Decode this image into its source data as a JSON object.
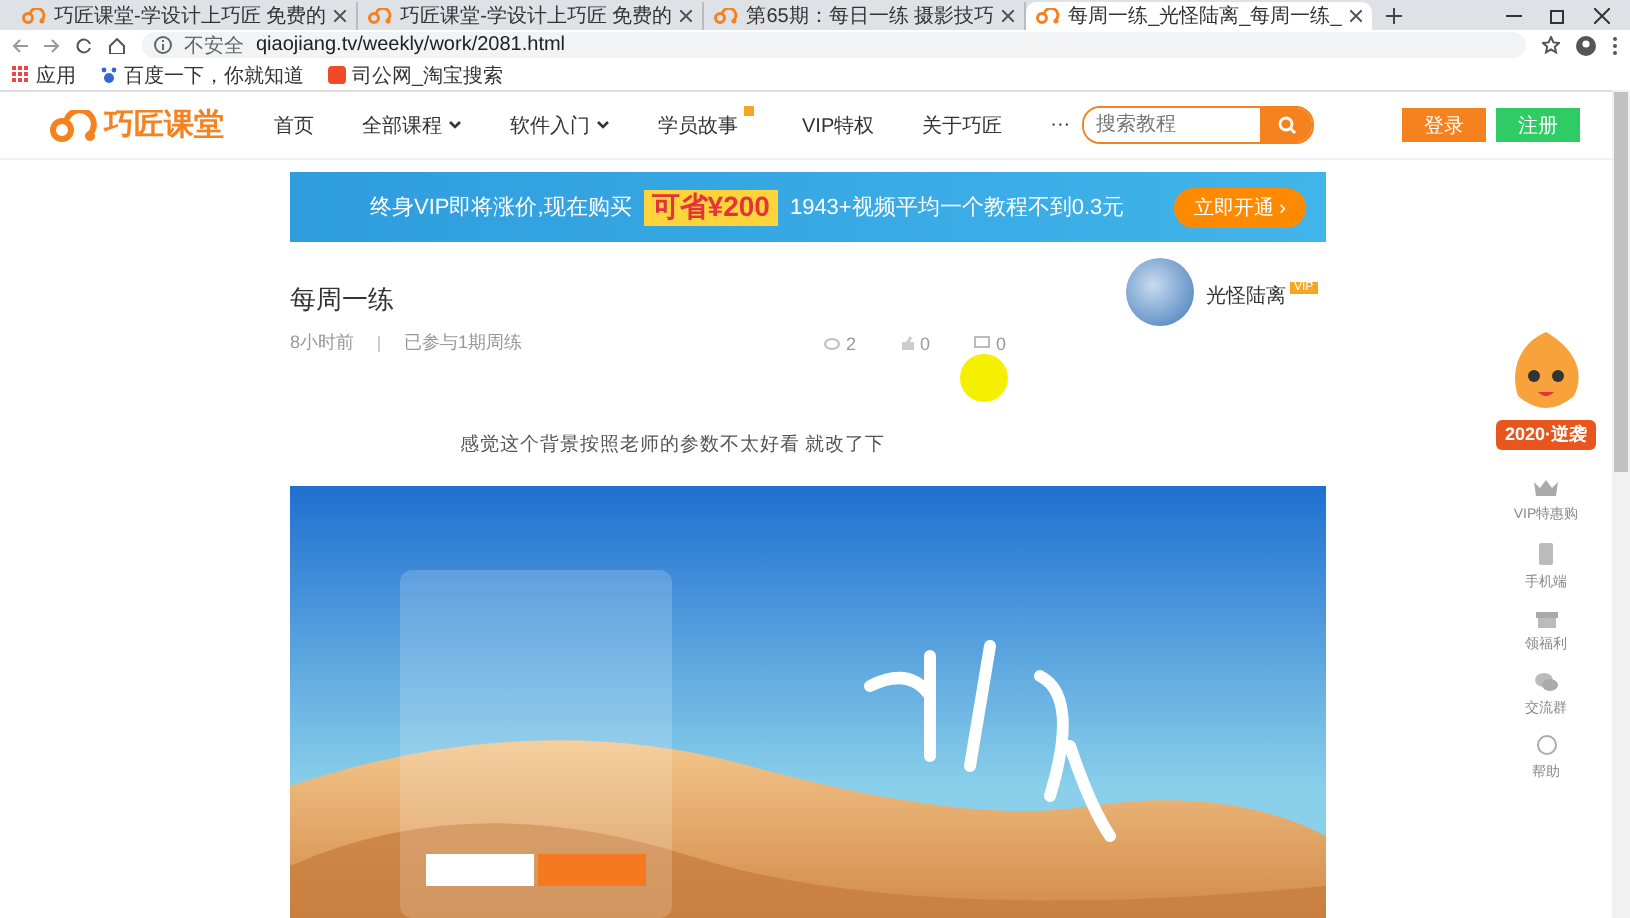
{
  "browser": {
    "tabs": [
      {
        "title": "巧匠课堂-学设计上巧匠 免费的",
        "selected": false
      },
      {
        "title": "巧匠课堂-学设计上巧匠 免费的",
        "selected": false
      },
      {
        "title": "第65期：每日一练 摄影技巧",
        "selected": false
      },
      {
        "title": "每周一练_光怪陆离_每周一练_",
        "selected": true
      }
    ],
    "security": "不安全",
    "address": "qiaojiang.tv/weekly/work/2081.html",
    "bookmarks": [
      {
        "kind": "apps",
        "label": "应用"
      },
      {
        "kind": "paw",
        "label": "百度一下，你就知道"
      },
      {
        "kind": "shop",
        "label": "司公网_淘宝搜索"
      }
    ]
  },
  "header": {
    "logo": "巧匠课堂",
    "nav": [
      {
        "label": "首页",
        "dropdown": false,
        "badge": false
      },
      {
        "label": "全部课程",
        "dropdown": true,
        "badge": false
      },
      {
        "label": "软件入门",
        "dropdown": true,
        "badge": false
      },
      {
        "label": "学员故事",
        "dropdown": false,
        "badge": true
      },
      {
        "label": "VIP特权",
        "dropdown": false,
        "badge": false
      },
      {
        "label": "关于巧匠",
        "dropdown": false,
        "badge": false
      },
      {
        "label": "···",
        "dropdown": false,
        "badge": false
      }
    ],
    "search": {
      "placeholder": "搜索教程"
    },
    "login": "登录",
    "register": "注册"
  },
  "banner": {
    "lead": "终身VIP即将涨价,现在购买",
    "highlight": "可省¥200",
    "offer": "1943+视频平均一个教程不到0.3元",
    "cta": "立即开通 ›"
  },
  "work": {
    "title": "每周一练",
    "time": "8小时前",
    "participation": "已参与1期周练",
    "stats": [
      {
        "kind": "views",
        "value": "2"
      },
      {
        "kind": "likes",
        "value": "0"
      },
      {
        "kind": "comments",
        "value": "0"
      }
    ],
    "author": {
      "name": "光怪陆离",
      "vip": "VIP"
    },
    "description": "感觉这个背景按照老师的参数不太好看 就改了下"
  },
  "sidebar": {
    "promo": "2020·逆袭",
    "items": [
      {
        "kind": "crown",
        "label": "VIP特惠购"
      },
      {
        "kind": "phone",
        "label": "手机端"
      },
      {
        "kind": "gift",
        "label": "领福利"
      },
      {
        "kind": "group",
        "label": "交流群"
      },
      {
        "kind": "help",
        "label": "帮助"
      }
    ]
  }
}
